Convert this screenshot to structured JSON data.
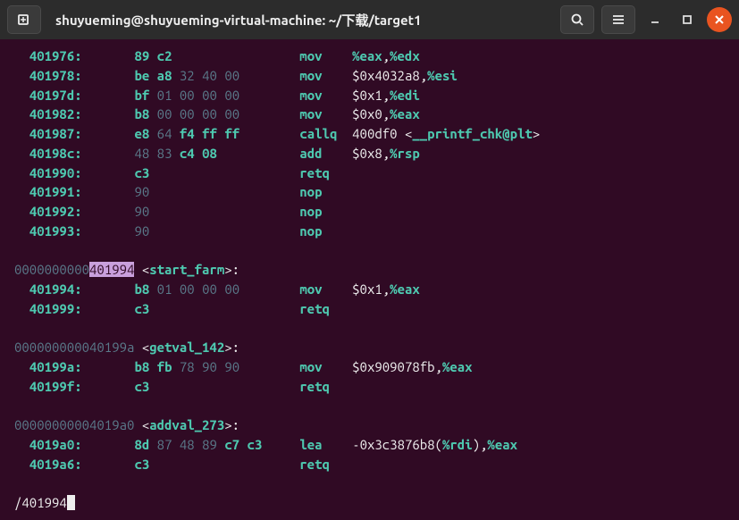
{
  "titlebar": {
    "title": "shuyueming@shuyueming-virtual-machine: ~/下载/target1"
  },
  "icons": {
    "newtab": "new-tab-icon",
    "search": "search-icon",
    "menu": "hamburger-icon",
    "minimize": "minimize-icon",
    "maximize": "maximize-icon",
    "close": "close-icon"
  },
  "disasm": {
    "lines": [
      {
        "addr": "401976",
        "bytes": [
          [
            "89",
            1
          ],
          [
            "c2",
            1
          ]
        ],
        "mn": "mov",
        "ops": [
          [
            "%eax",
            1
          ],
          [
            ",",
            0
          ],
          [
            "%edx",
            1
          ]
        ]
      },
      {
        "addr": "401978",
        "bytes": [
          [
            "be",
            1
          ],
          [
            "a8",
            1
          ],
          [
            "32",
            0
          ],
          [
            "40",
            0
          ],
          [
            "00",
            0
          ]
        ],
        "mn": "mov",
        "ops": [
          [
            "$0x4032a8",
            0
          ],
          [
            ",",
            0
          ],
          [
            "%esi",
            1
          ]
        ]
      },
      {
        "addr": "40197d",
        "bytes": [
          [
            "bf",
            1
          ],
          [
            "01",
            0
          ],
          [
            "00",
            0
          ],
          [
            "00",
            0
          ],
          [
            "00",
            0
          ]
        ],
        "mn": "mov",
        "ops": [
          [
            "$0x1",
            0
          ],
          [
            ",",
            0
          ],
          [
            "%edi",
            1
          ]
        ]
      },
      {
        "addr": "401982",
        "bytes": [
          [
            "b8",
            1
          ],
          [
            "00",
            0
          ],
          [
            "00",
            0
          ],
          [
            "00",
            0
          ],
          [
            "00",
            0
          ]
        ],
        "mn": "mov",
        "ops": [
          [
            "$0x0",
            0
          ],
          [
            ",",
            0
          ],
          [
            "%eax",
            1
          ]
        ]
      },
      {
        "addr": "401987",
        "bytes": [
          [
            "e8",
            1
          ],
          [
            "64",
            0
          ],
          [
            "f4",
            1
          ],
          [
            "ff",
            1
          ],
          [
            "ff",
            1
          ]
        ],
        "mn": "callq",
        "ops": [
          [
            "400df0 ",
            0
          ]
        ],
        "sym": "__printf_chk@plt"
      },
      {
        "addr": "40198c",
        "bytes": [
          [
            "48",
            0
          ],
          [
            "83",
            0
          ],
          [
            "c4",
            1
          ],
          [
            "08",
            1
          ]
        ],
        "mn": "add",
        "ops": [
          [
            "$0x8",
            0
          ],
          [
            ",",
            0
          ],
          [
            "%rsp",
            1
          ]
        ]
      },
      {
        "addr": "401990",
        "bytes": [
          [
            "c3",
            1
          ]
        ],
        "mn": "retq",
        "ops": []
      },
      {
        "addr": "401991",
        "bytes": [
          [
            "90",
            0
          ]
        ],
        "mn": "nop",
        "ops": []
      },
      {
        "addr": "401992",
        "bytes": [
          [
            "90",
            0
          ]
        ],
        "mn": "nop",
        "ops": []
      },
      {
        "addr": "401993",
        "bytes": [
          [
            "90",
            0
          ]
        ],
        "mn": "nop",
        "ops": []
      }
    ],
    "section1": {
      "addr_prefix": "0000000000",
      "addr_hl": "401994",
      "name": "start_farm"
    },
    "lines1": [
      {
        "addr": "401994",
        "bytes": [
          [
            "b8",
            1
          ],
          [
            "01",
            0
          ],
          [
            "00",
            0
          ],
          [
            "00",
            0
          ],
          [
            "00",
            0
          ]
        ],
        "mn": "mov",
        "ops": [
          [
            "$0x1",
            0
          ],
          [
            ",",
            0
          ],
          [
            "%eax",
            1
          ]
        ]
      },
      {
        "addr": "401999",
        "bytes": [
          [
            "c3",
            1
          ]
        ],
        "mn": "retq",
        "ops": []
      }
    ],
    "section2": {
      "addr": "000000000040199a",
      "name": "getval_142"
    },
    "lines2": [
      {
        "addr": "40199a",
        "bytes": [
          [
            "b8",
            1
          ],
          [
            "fb",
            1
          ],
          [
            "78",
            0
          ],
          [
            "90",
            0
          ],
          [
            "90",
            0
          ]
        ],
        "mn": "mov",
        "ops": [
          [
            "$0x909078fb",
            0
          ],
          [
            ",",
            0
          ],
          [
            "%eax",
            1
          ]
        ]
      },
      {
        "addr": "40199f",
        "bytes": [
          [
            "c3",
            1
          ]
        ],
        "mn": "retq",
        "ops": []
      }
    ],
    "section3": {
      "addr": "00000000004019a0",
      "name": "addval_273"
    },
    "lines3": [
      {
        "addr": "4019a0",
        "bytes": [
          [
            "8d",
            1
          ],
          [
            "87",
            0
          ],
          [
            "48",
            0
          ],
          [
            "89",
            0
          ],
          [
            "c7",
            1
          ],
          [
            "c3",
            1
          ]
        ],
        "mn": "lea",
        "ops": [
          [
            "-0x3c3876b8(",
            0
          ],
          [
            "%rdi",
            1
          ],
          [
            "),",
            0
          ],
          [
            "%eax",
            1
          ]
        ]
      },
      {
        "addr": "4019a6",
        "bytes": [
          [
            "c3",
            1
          ]
        ],
        "mn": "retq",
        "ops": []
      }
    ]
  },
  "search": {
    "prefix": "/",
    "query": "401994"
  }
}
